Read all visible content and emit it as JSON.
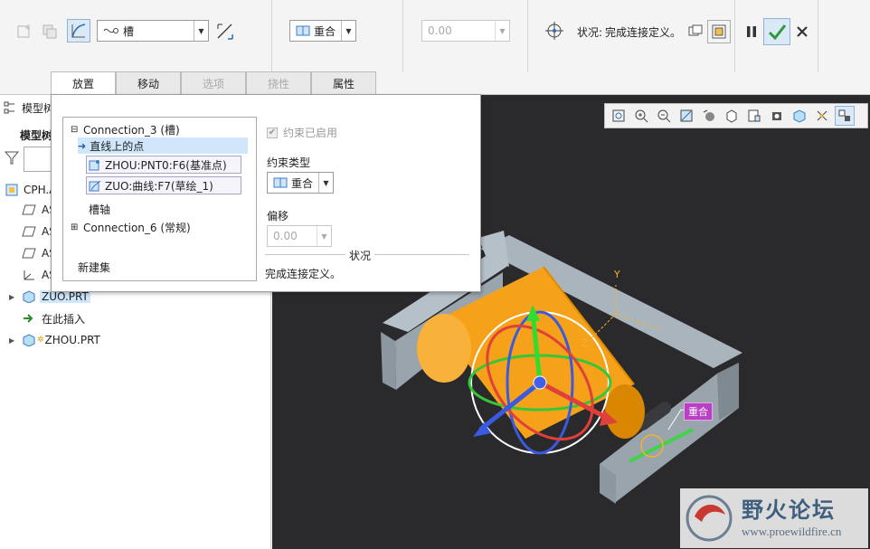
{
  "dashboard": {
    "connection_type": "槽",
    "constraint_type": "重合",
    "offset_value": "0.00",
    "status_label": "状况:",
    "status_text": "完成连接定义。"
  },
  "tabs": [
    {
      "label": "放置",
      "state": "active"
    },
    {
      "label": "移动",
      "state": "normal"
    },
    {
      "label": "选项",
      "state": "disabled"
    },
    {
      "label": "挠性",
      "state": "disabled"
    },
    {
      "label": "属性",
      "state": "normal"
    }
  ],
  "tree": {
    "header": "模型树",
    "header_truncated": "模型树",
    "subheader": "模型树",
    "root": "CPH.A",
    "items": [
      {
        "label": "AS",
        "icon": "datum-plane-icon"
      },
      {
        "label": "AS",
        "icon": "datum-plane-icon"
      },
      {
        "label": "AS",
        "icon": "datum-plane-icon"
      },
      {
        "label": "AS",
        "icon": "coordinate-system-icon"
      },
      {
        "label": "ZUO.PRT",
        "icon": "part-icon",
        "selected": true
      },
      {
        "label": "在此插入",
        "icon": "insert-here-icon"
      },
      {
        "label": "ZHOU.PRT",
        "icon": "part-icon"
      }
    ]
  },
  "placement": {
    "connection3": "Connection_3 (槽)",
    "point_on_line": "直线上的点",
    "ref1": "ZHOU:PNT0:F6(基准点)",
    "ref2": "ZUO:曲线:F7(草绘_1)",
    "slot_axis": "槽轴",
    "connection6": "Connection_6 (常规)",
    "new_set": "新建集",
    "constraint_enabled": "约束已启用",
    "constraint_type_label": "约束类型",
    "constraint_type_value": "重合",
    "offset_label": "偏移",
    "offset_value": "0.00",
    "status_section": "状况",
    "status_text": "完成连接定义。"
  },
  "graphics": {
    "coincident_tag": "重合",
    "axis_y": "Y",
    "axis_z": "Z"
  },
  "watermark": {
    "title": "野火论坛",
    "url": "www.proewildfire.cn"
  },
  "colors": {
    "accent_blue": "#8fb2d8",
    "tag_magenta": "#b93fc3",
    "part_orange": "#f6a11a",
    "bracket_gray": "#9aa4ad"
  }
}
